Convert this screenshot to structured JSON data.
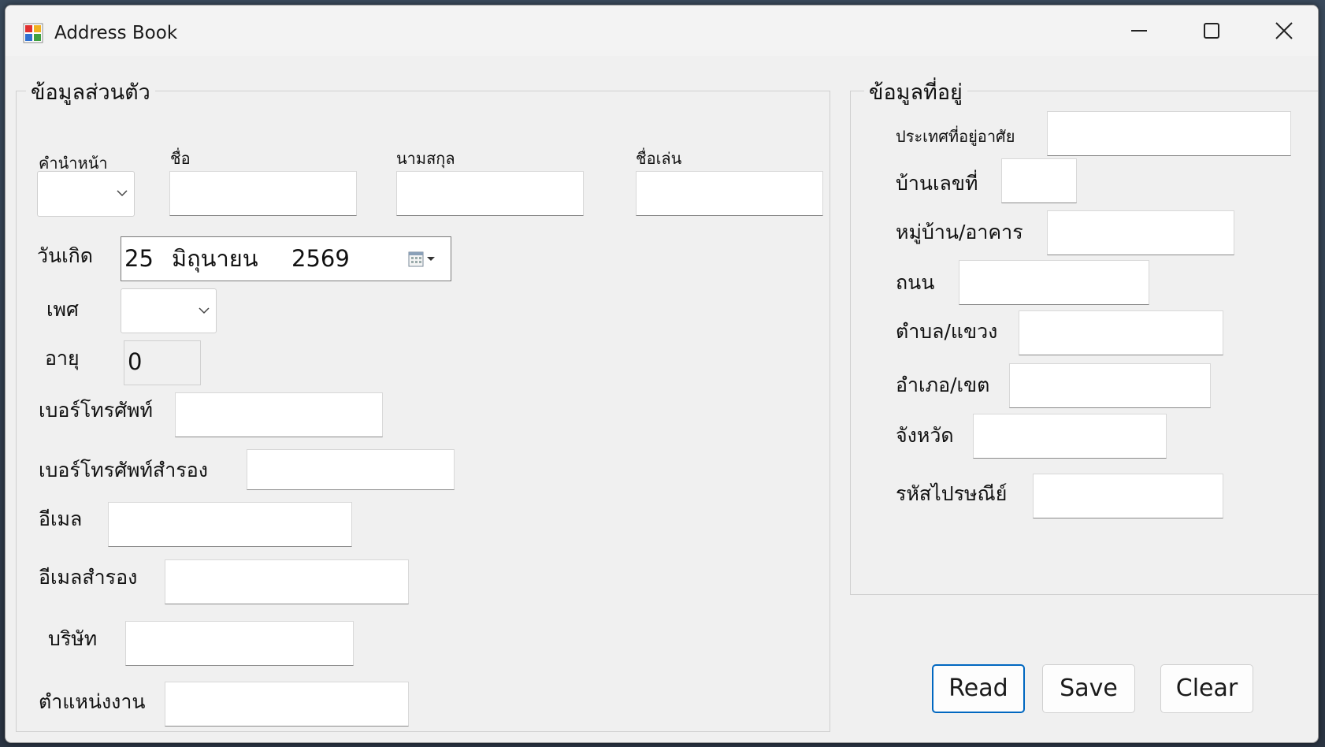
{
  "window": {
    "title": "Address Book"
  },
  "personal": {
    "group_title": "ข้อมูลส่วนตัว",
    "prefix_label": "คำนำหน้า",
    "firstname_label": "ชื่อ",
    "lastname_label": "นามสกุล",
    "nickname_label": "ชื่อเล่น",
    "birthdate_label": "วันเกิด",
    "birthdate": {
      "day": "25",
      "month": "มิถุนายน",
      "year": "2569"
    },
    "gender_label": "เพศ",
    "age_label": "อายุ",
    "age_value": "0",
    "phone_label": "เบอร์โทรศัพท์",
    "phone_alt_label": "เบอร์โทรศัพท์สำรอง",
    "email_label": "อีเมล",
    "email_alt_label": "อีเมลสำรอง",
    "company_label": "บริษัท",
    "position_label": "ตำแหน่งงาน"
  },
  "address": {
    "group_title": "ข้อมูลที่อยู่",
    "country_label": "ประเทศที่อยู่อาศัย",
    "house_no_label": "บ้านเลขที่",
    "village_label": "หมู่บ้าน/อาคาร",
    "road_label": "ถนน",
    "subdistrict_label": "ตำบล/แขวง",
    "district_label": "อำเภอ/เขต",
    "province_label": "จังหวัด",
    "postcode_label": "รหัสไปรษณีย์"
  },
  "buttons": {
    "read": "Read",
    "save": "Save",
    "clear": "Clear"
  },
  "colors": {
    "accent": "#0067c0",
    "window_bg": "#f0f0f0"
  }
}
